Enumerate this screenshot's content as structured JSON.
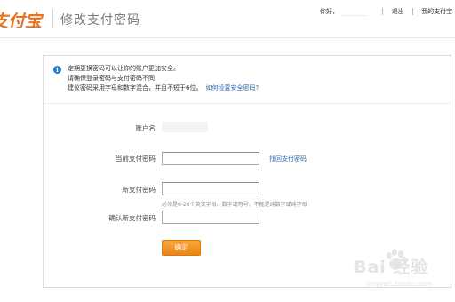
{
  "header": {
    "logo_text": "支付宝",
    "page_title": "修改支付密码",
    "nav": {
      "greeting": "你好，",
      "logout": "退出",
      "my_alipay": "我的支付宝"
    }
  },
  "notice": {
    "icon": "info-icon",
    "line1": "定期更换密码可以让你的账户更加安全。",
    "line2": "请确保登录密码与支付密码不同!",
    "line3": "建议密码采用字母和数字混合，并且不短于6位。",
    "link": "如何设置安全密码?"
  },
  "form": {
    "account_label": "账户名",
    "current_password_label": "当前支付密码",
    "current_password_value": "",
    "forgot_link": "找回支付密码",
    "new_password_label": "新支付密码",
    "new_password_value": "",
    "new_password_hint": "必须是6-20个英文字母、数字或符号，不能是纯数字或纯字母",
    "confirm_password_label": "确认新支付密码",
    "confirm_password_value": "",
    "submit_label": "确定"
  },
  "colors": {
    "brand_blue": "#1a6fb8",
    "brand_orange": "#e6731e",
    "link": "#2d6bb0",
    "button": "#ec8412"
  },
  "watermark": {
    "text": "Bai 经验",
    "sub": "jingyan.baidu.com"
  }
}
